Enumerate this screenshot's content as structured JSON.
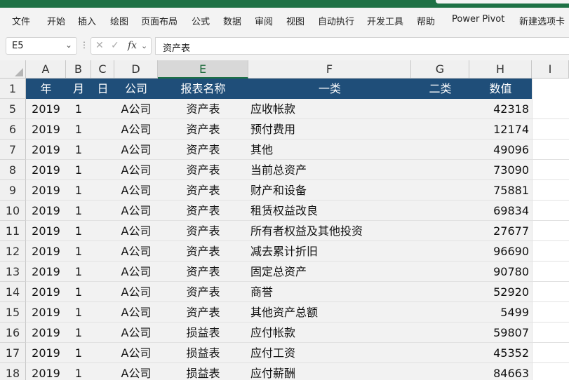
{
  "ribbon": {
    "tabs": [
      "文件",
      "开始",
      "插入",
      "绘图",
      "页面布局",
      "公式",
      "数据",
      "审阅",
      "视图",
      "自动执行",
      "开发工具",
      "帮助",
      "Power Pivot",
      "新建选项卡"
    ]
  },
  "formula_bar": {
    "name_box": "E5",
    "formula": "资产表"
  },
  "columns": [
    "A",
    "B",
    "C",
    "D",
    "E",
    "F",
    "G",
    "H",
    "I"
  ],
  "selected_column": "E",
  "header_row": {
    "row_number": "1",
    "cells": [
      "年",
      "月",
      "日",
      "公司",
      "报表名称",
      "一类",
      "二类",
      "数值"
    ]
  },
  "rows": [
    {
      "row_number": "5",
      "year": "2019",
      "month": "1",
      "day": "",
      "company": "A公司",
      "report": "资产表",
      "cat1": "应收帐款",
      "cat2": "",
      "value": "42318"
    },
    {
      "row_number": "6",
      "year": "2019",
      "month": "1",
      "day": "",
      "company": "A公司",
      "report": "资产表",
      "cat1": "预付费用",
      "cat2": "",
      "value": "12174"
    },
    {
      "row_number": "7",
      "year": "2019",
      "month": "1",
      "day": "",
      "company": "A公司",
      "report": "资产表",
      "cat1": "其他",
      "cat2": "",
      "value": "49096"
    },
    {
      "row_number": "8",
      "year": "2019",
      "month": "1",
      "day": "",
      "company": "A公司",
      "report": "资产表",
      "cat1": "当前总资产",
      "cat2": "",
      "value": "73090"
    },
    {
      "row_number": "9",
      "year": "2019",
      "month": "1",
      "day": "",
      "company": "A公司",
      "report": "资产表",
      "cat1": "财产和设备",
      "cat2": "",
      "value": "75881"
    },
    {
      "row_number": "10",
      "year": "2019",
      "month": "1",
      "day": "",
      "company": "A公司",
      "report": "资产表",
      "cat1": "租赁权益改良",
      "cat2": "",
      "value": "69834"
    },
    {
      "row_number": "11",
      "year": "2019",
      "month": "1",
      "day": "",
      "company": "A公司",
      "report": "资产表",
      "cat1": "所有者权益及其他投资",
      "cat2": "",
      "value": "27677"
    },
    {
      "row_number": "12",
      "year": "2019",
      "month": "1",
      "day": "",
      "company": "A公司",
      "report": "资产表",
      "cat1": "减去累计折旧",
      "cat2": "",
      "value": "96690"
    },
    {
      "row_number": "13",
      "year": "2019",
      "month": "1",
      "day": "",
      "company": "A公司",
      "report": "资产表",
      "cat1": "固定总资产",
      "cat2": "",
      "value": "90780"
    },
    {
      "row_number": "14",
      "year": "2019",
      "month": "1",
      "day": "",
      "company": "A公司",
      "report": "资产表",
      "cat1": "商誉",
      "cat2": "",
      "value": "52920"
    },
    {
      "row_number": "15",
      "year": "2019",
      "month": "1",
      "day": "",
      "company": "A公司",
      "report": "资产表",
      "cat1": "其他资产总额",
      "cat2": "",
      "value": "5499"
    },
    {
      "row_number": "16",
      "year": "2019",
      "month": "1",
      "day": "",
      "company": "A公司",
      "report": "损益表",
      "cat1": "应付帐款",
      "cat2": "",
      "value": "59807"
    },
    {
      "row_number": "17",
      "year": "2019",
      "month": "1",
      "day": "",
      "company": "A公司",
      "report": "损益表",
      "cat1": "应付工资",
      "cat2": "",
      "value": "45352"
    },
    {
      "row_number": "18",
      "year": "2019",
      "month": "1",
      "day": "",
      "company": "A公司",
      "report": "损益表",
      "cat1": "应付薪酬",
      "cat2": "",
      "value": "84663"
    }
  ],
  "colors": {
    "header_fill": "#1f4e79",
    "header_text": "#ffffff",
    "data_fill": "#f2f2f2",
    "excel_green": "#1e7145"
  }
}
